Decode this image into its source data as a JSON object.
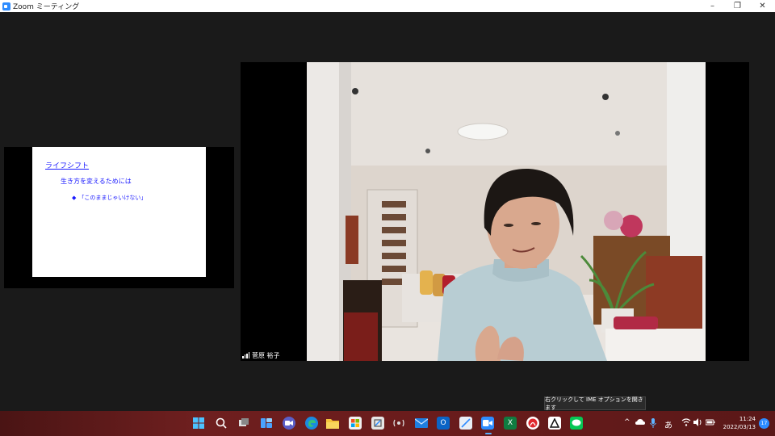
{
  "window": {
    "title": "Zoom ミーティング",
    "minimize": "–",
    "restore": "❐",
    "close": "✕"
  },
  "shared_slide": {
    "title": "ライフシフト",
    "subtitle": "生き方を変えるためには",
    "bullet_marker": "◆",
    "bullet": "「このままじゃいけない」"
  },
  "participant": {
    "name": "菅原 裕子"
  },
  "ime_tooltip": "右クリックして IME オプションを開きます",
  "tray": {
    "ime_mode": "あ",
    "time": "11:24",
    "date": "2022/03/13",
    "notifications": "17",
    "overflow": "^"
  },
  "colors": {
    "slide_text": "#1a1aff",
    "zoom_blue": "#2d8cff",
    "taskbar": "#6e1f1f"
  }
}
